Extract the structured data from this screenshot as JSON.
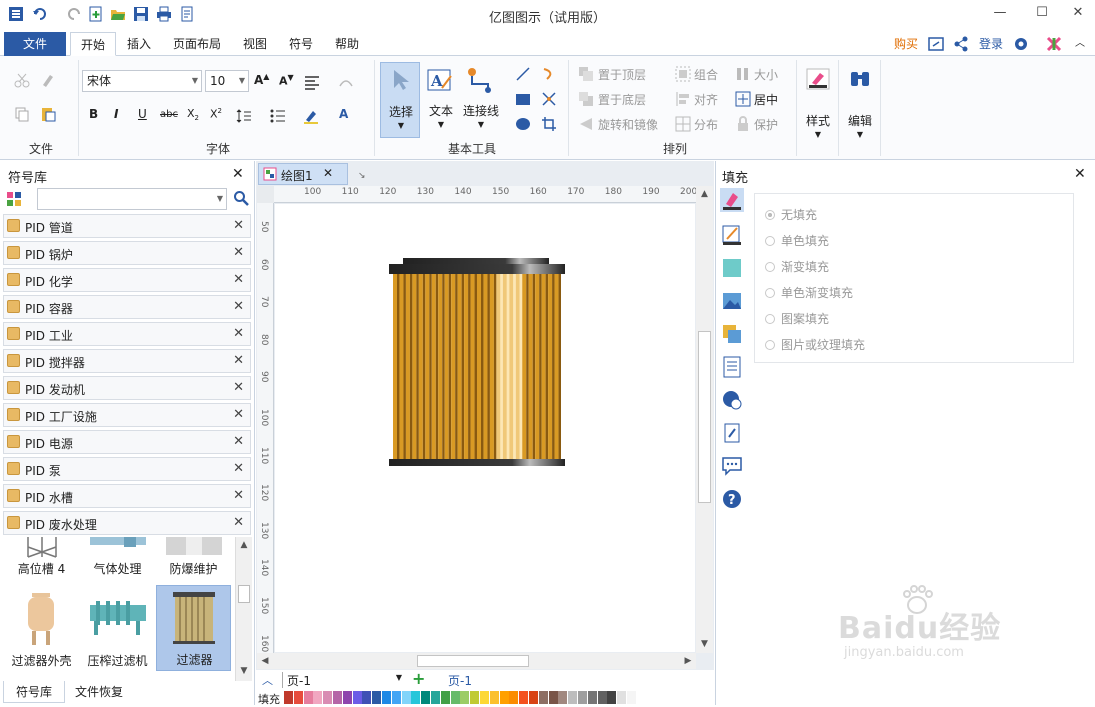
{
  "app": {
    "title": "亿图图示（试用版）"
  },
  "tabs": [
    "文件",
    "开始",
    "插入",
    "页面布局",
    "视图",
    "符号",
    "帮助"
  ],
  "topright": {
    "buy": "购买",
    "login": "登录"
  },
  "ribbon": {
    "file_group": "文件",
    "font_group": "字体",
    "font_name": "宋体",
    "font_size": "10",
    "basic_group": "基本工具",
    "select": "选择",
    "text": "文本",
    "connector": "连接线",
    "arrange_group": "排列",
    "to_top": "置于顶层",
    "to_bottom": "置于底层",
    "rotate": "旋转和镜像",
    "group": "组合",
    "align": "对齐",
    "distribute": "分布",
    "size": "大小",
    "center": "居中",
    "protect": "保护",
    "style": "样式",
    "edit": "编辑"
  },
  "left": {
    "title": "符号库",
    "libraries": [
      "PID 管道",
      "PID 锅炉",
      "PID 化学",
      "PID 容器",
      "PID 工业",
      "PID 搅拌器",
      "PID 发动机",
      "PID 工厂设施",
      "PID 电源",
      "PID 泵",
      "PID 水槽",
      "PID 废水处理"
    ],
    "shapes": [
      "高位槽 4",
      "气体处理",
      "防爆维护",
      "过滤器外壳",
      "压榨过滤机",
      "过滤器"
    ],
    "bottom_tabs": [
      "符号库",
      "文件恢复"
    ]
  },
  "canvas": {
    "doc_tab": "绘图1",
    "ruler_h": [
      "100",
      "110",
      "120",
      "130",
      "140",
      "150",
      "160",
      "170",
      "180",
      "190",
      "200"
    ],
    "ruler_v": [
      "50",
      "60",
      "70",
      "80",
      "90",
      "100",
      "110",
      "120",
      "130",
      "140",
      "150",
      "160"
    ],
    "page_select": "页-1",
    "page_tab": "页-1",
    "fill_label": "填充"
  },
  "fill": {
    "title": "填充",
    "options": [
      "无填充",
      "单色填充",
      "渐变填充",
      "单色渐变填充",
      "图案填充",
      "图片或纹理填充"
    ]
  },
  "colors": {
    "file_tab": "#2b5aa5",
    "accent": "#2b5aa5",
    "filter_body": "#d99a24",
    "filter_cap": "#333333",
    "buy": "#e06c00"
  },
  "watermark": {
    "brand": "Baidu经验",
    "url": "jingyan.baidu.com"
  }
}
